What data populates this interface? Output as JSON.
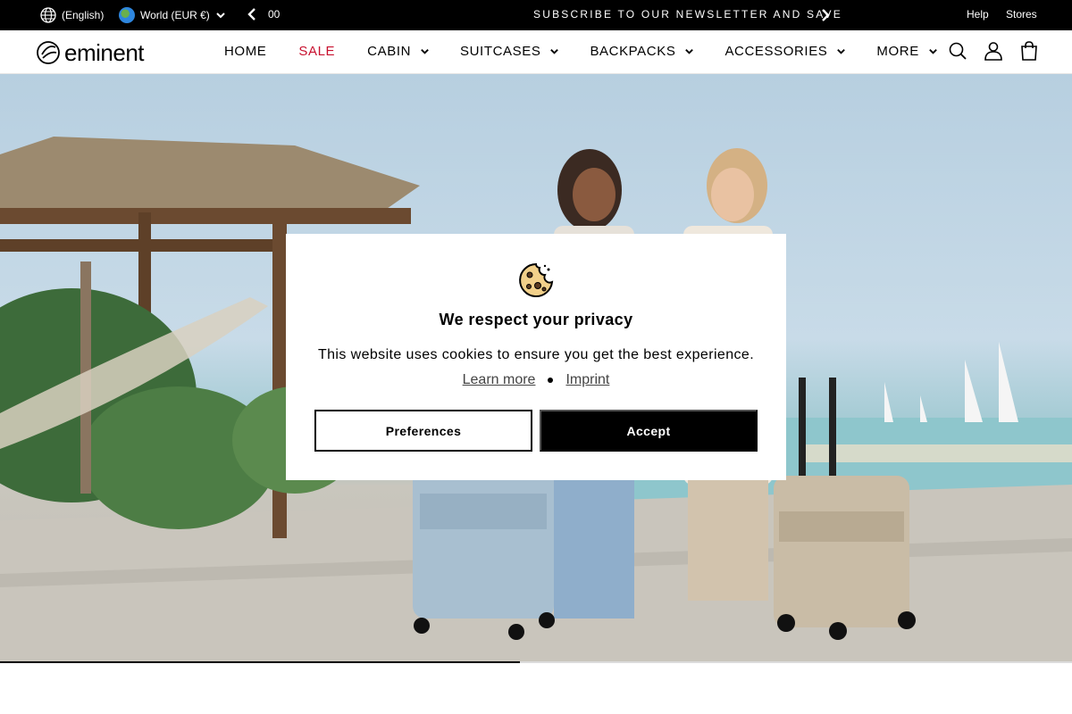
{
  "topbar": {
    "language": "(English)",
    "region": "World (EUR €)",
    "counter": "00",
    "announcement": "SUBSCRIBE TO OUR NEWSLETTER AND SAVE",
    "help": "Help",
    "stores": "Stores"
  },
  "header": {
    "logo_text": "eminent",
    "nav": [
      {
        "label": "HOME"
      },
      {
        "label": "SALE"
      },
      {
        "label": "CABIN"
      },
      {
        "label": "SUITCASES"
      },
      {
        "label": "BACKPACKS"
      },
      {
        "label": "ACCESSORIES"
      },
      {
        "label": "MORE"
      }
    ],
    "icons": [
      "search-icon",
      "account-icon",
      "cart-icon"
    ]
  },
  "hero": {
    "slide_progress": 0.485
  },
  "cookie_modal": {
    "title": "We respect your privacy",
    "message": "This website uses cookies to ensure you get the best experience.",
    "learn_more": "Learn more",
    "imprint": "Imprint",
    "preferences_label": "Preferences",
    "accept_label": "Accept"
  },
  "colors": {
    "brand_black": "#000000",
    "sale_red": "#c8102e"
  }
}
